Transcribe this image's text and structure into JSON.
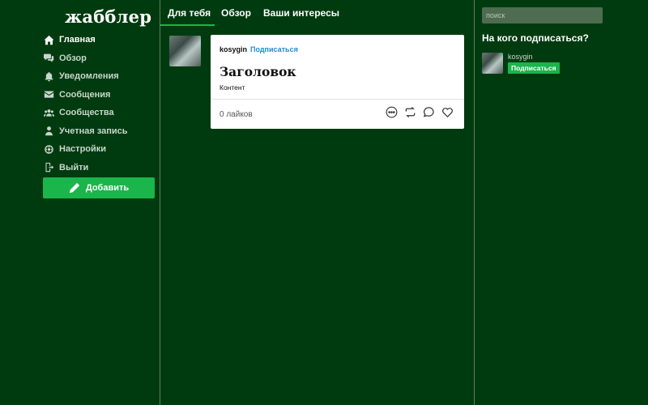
{
  "app": {
    "logo": "жабблер"
  },
  "sidebar": {
    "items": [
      {
        "label": "Главная",
        "icon": "home-icon",
        "active": true
      },
      {
        "label": "Обзор",
        "icon": "chat-bubbles-icon",
        "active": false
      },
      {
        "label": "Уведомления",
        "icon": "bell-icon",
        "active": false
      },
      {
        "label": "Сообщения",
        "icon": "envelope-icon",
        "active": false
      },
      {
        "label": "Сообщества",
        "icon": "users-icon",
        "active": false
      },
      {
        "label": "Учетная запись",
        "icon": "user-icon",
        "active": false
      },
      {
        "label": "Настройки",
        "icon": "gear-icon",
        "active": false
      },
      {
        "label": "Выйти",
        "icon": "logout-icon",
        "active": false
      }
    ],
    "add_button": {
      "label": "Добавить",
      "icon": "pencil-icon"
    }
  },
  "main": {
    "tabs": [
      {
        "label": "Для тебя",
        "active": true
      },
      {
        "label": "Обзор",
        "active": false
      },
      {
        "label": "Ваши интересы",
        "active": false
      }
    ],
    "post": {
      "author": "kosygin",
      "follow_label": "Подписаться",
      "title": "Заголовок",
      "content": "Контент",
      "likes": "0 лайков",
      "actions": [
        "more-icon",
        "repost-icon",
        "comment-icon",
        "heart-icon"
      ]
    }
  },
  "right": {
    "search": {
      "placeholder": "поиск",
      "value": ""
    },
    "suggest_title": "На кого подписаться?",
    "suggestions": [
      {
        "name": "kosygin",
        "follow_label": "Подписаться"
      }
    ]
  },
  "colors": {
    "background": "#003b10",
    "accent": "#1ab54b",
    "link": "#1a8fd8",
    "divider": "#5f7f63"
  }
}
